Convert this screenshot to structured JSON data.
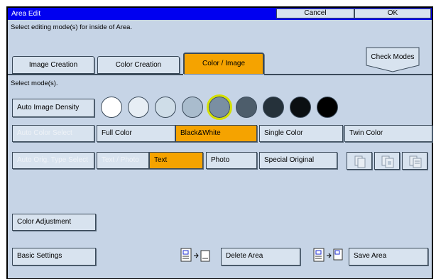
{
  "window": {
    "title": "Area Edit",
    "cancel_label": "Cancel",
    "ok_label": "OK"
  },
  "instruction": "Select editing mode(s) for inside of Area.",
  "tabs": [
    {
      "label": "Image Creation",
      "active": false
    },
    {
      "label": "Color Creation",
      "active": false
    },
    {
      "label": "Color / Image",
      "active": true
    }
  ],
  "check_modes_label": "Check Modes",
  "select_modes_label": "Select mode(s).",
  "auto_image_density_label": "Auto Image Density",
  "density_levels": {
    "count": 9,
    "selected_index": 4,
    "colors": [
      "#ffffff",
      "#e7eef5",
      "#cfdde8",
      "#a9bccd",
      "#7a8fa2",
      "#4d5d6b",
      "#25313a",
      "#0b0f12",
      "#000000"
    ]
  },
  "color_modes": {
    "options": [
      "Auto Color Select",
      "Full Color",
      "Black&White",
      "Single Color",
      "Twin Color"
    ],
    "selected": "Black&White",
    "disabled": [
      "Auto Color Select"
    ]
  },
  "original_types": {
    "options": [
      "Auto Orig. Type Select",
      "Text / Photo",
      "Text",
      "Photo",
      "Special Original"
    ],
    "selected": "Text",
    "disabled": [
      "Auto Orig. Type Select",
      "Text / Photo"
    ]
  },
  "color_adjustment_label": "Color Adjustment",
  "basic_settings_label": "Basic Settings",
  "delete_area_label": "Delete Area",
  "save_area_label": "Save Area",
  "colors": {
    "accent": "#f5a300",
    "title_bar": "#0000f0",
    "panel": "#c6d4e6",
    "button": "#d8e3ef",
    "highlight_ring": "#d4e000"
  }
}
